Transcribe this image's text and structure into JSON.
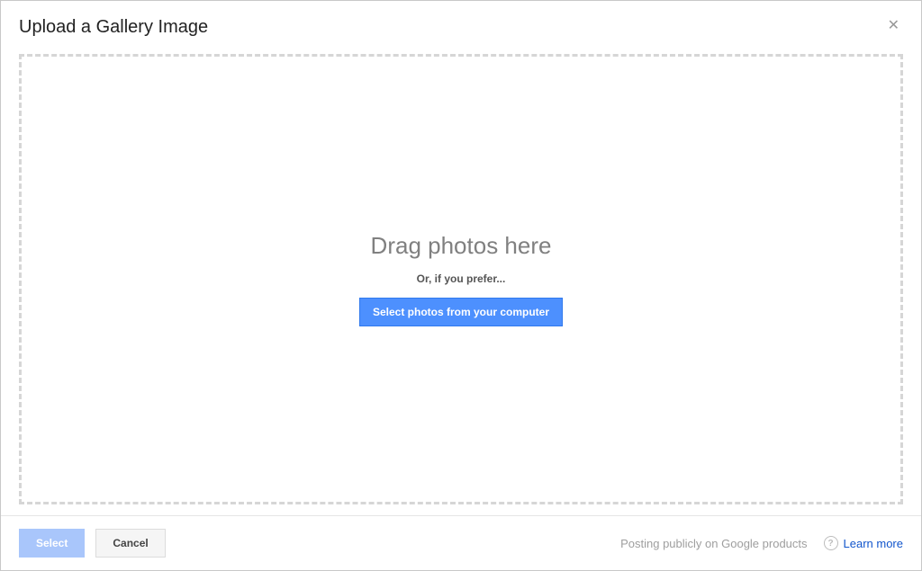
{
  "header": {
    "title": "Upload a Gallery Image"
  },
  "body": {
    "drag_text": "Drag photos here",
    "or_text": "Or, if you prefer...",
    "select_button_label": "Select photos from your computer"
  },
  "footer": {
    "select_label": "Select",
    "cancel_label": "Cancel",
    "posting_text": "Posting publicly on Google products",
    "help_symbol": "?",
    "learn_more_label": "Learn more"
  }
}
